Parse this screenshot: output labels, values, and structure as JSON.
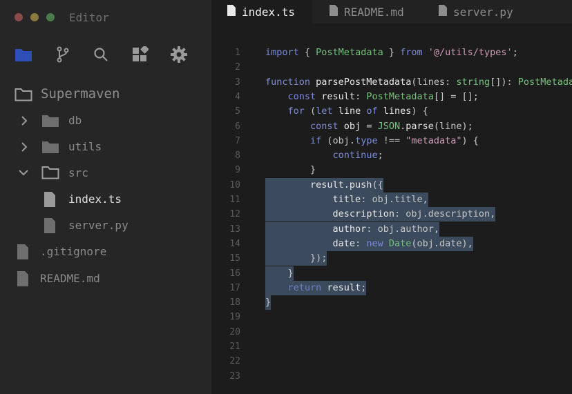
{
  "app": {
    "title": "Editor"
  },
  "activity_bar": [
    {
      "name": "explorer-icon"
    },
    {
      "name": "source-control-icon"
    },
    {
      "name": "search-icon"
    },
    {
      "name": "extensions-icon"
    },
    {
      "name": "settings-icon"
    }
  ],
  "explorer": {
    "root": "Supermaven",
    "items": [
      {
        "label": "db",
        "type": "folder",
        "expanded": false
      },
      {
        "label": "utils",
        "type": "folder",
        "expanded": false
      },
      {
        "label": "src",
        "type": "folder",
        "expanded": true
      },
      {
        "label": "index.ts",
        "type": "file",
        "selected": true
      },
      {
        "label": "server.py",
        "type": "file"
      },
      {
        "label": ".gitignore",
        "type": "file"
      },
      {
        "label": "README.md",
        "type": "file"
      }
    ]
  },
  "tabs": [
    {
      "label": "index.ts",
      "active": true
    },
    {
      "label": "README.md",
      "active": false
    },
    {
      "label": "server.py",
      "active": false
    }
  ],
  "code": {
    "line_numbers": [
      "1",
      "2",
      "3",
      "4",
      "5",
      "6",
      "7",
      "8",
      "9",
      "10",
      "11",
      "12",
      "13",
      "14",
      "15",
      "16",
      "17",
      "18",
      "19",
      "20",
      "21",
      "22",
      "23"
    ],
    "highlighted_lines": [
      10,
      11,
      12,
      13,
      14,
      15,
      16,
      17,
      18
    ],
    "lines": [
      [
        [
          "k",
          "import"
        ],
        [
          "p",
          " { "
        ],
        [
          "t",
          "PostMetadata"
        ],
        [
          "p",
          " } "
        ],
        [
          "k",
          "from"
        ],
        [
          "p",
          " "
        ],
        [
          "s",
          "'@/utils/types'"
        ],
        [
          "p",
          ";"
        ]
      ],
      [],
      [
        [
          "k",
          "function"
        ],
        [
          "f",
          " parsePostMetadata"
        ],
        [
          "p",
          "(lines: "
        ],
        [
          "t",
          "string"
        ],
        [
          "p",
          "[]): "
        ],
        [
          "t",
          "PostMetadat"
        ]
      ],
      [
        [
          "p",
          "    "
        ],
        [
          "k",
          "const"
        ],
        [
          "f",
          " result"
        ],
        [
          "p",
          ": "
        ],
        [
          "t",
          "PostMetadata"
        ],
        [
          "p",
          "[] = [];"
        ]
      ],
      [
        [
          "p",
          "    "
        ],
        [
          "k",
          "for"
        ],
        [
          "p",
          " ("
        ],
        [
          "k",
          "let"
        ],
        [
          "f",
          " line"
        ],
        [
          "p",
          " "
        ],
        [
          "k",
          "of"
        ],
        [
          "f",
          " lines"
        ],
        [
          "p",
          ") {"
        ]
      ],
      [
        [
          "p",
          "        "
        ],
        [
          "k",
          "const"
        ],
        [
          "f",
          " obj"
        ],
        [
          "p",
          " = "
        ],
        [
          "t",
          "JSON"
        ],
        [
          "p",
          "."
        ],
        [
          "f",
          "parse"
        ],
        [
          "p",
          "(line);"
        ]
      ],
      [
        [
          "p",
          "        "
        ],
        [
          "k",
          "if"
        ],
        [
          "p",
          " (obj."
        ],
        [
          "k",
          "type"
        ],
        [
          "p",
          " !== "
        ],
        [
          "s",
          "\"metadata\""
        ],
        [
          "p",
          ") {"
        ]
      ],
      [
        [
          "p",
          "            "
        ],
        [
          "k",
          "continue"
        ],
        [
          "p",
          ";"
        ]
      ],
      [
        [
          "p",
          "        }"
        ]
      ],
      [
        [
          "p",
          "        "
        ],
        [
          "f",
          "result.push"
        ],
        [
          "p",
          "({"
        ]
      ],
      [
        [
          "p",
          "            "
        ],
        [
          "f",
          "title"
        ],
        [
          "p",
          ": obj.title,"
        ]
      ],
      [
        [
          "p",
          "            "
        ],
        [
          "f",
          "description"
        ],
        [
          "p",
          ": obj.description,"
        ]
      ],
      [
        [
          "p",
          "            "
        ],
        [
          "f",
          "author"
        ],
        [
          "p",
          ": obj.author,"
        ]
      ],
      [
        [
          "p",
          "            "
        ],
        [
          "f",
          "date"
        ],
        [
          "p",
          ": "
        ],
        [
          "k",
          "new"
        ],
        [
          "p",
          " "
        ],
        [
          "t",
          "Date"
        ],
        [
          "p",
          "(obj.date),"
        ]
      ],
      [
        [
          "p",
          "        });"
        ]
      ],
      [
        [
          "p",
          "    }"
        ]
      ],
      [
        [
          "p",
          "    "
        ],
        [
          "dim",
          "return"
        ],
        [
          "f",
          " result"
        ],
        [
          "p",
          ";"
        ]
      ],
      [
        [
          "p",
          "}"
        ]
      ],
      [],
      [],
      [],
      [],
      []
    ]
  },
  "colors": {
    "sidebar_bg": "#262626",
    "editor_bg": "#1c1c1c",
    "selection": "#3b4a5c",
    "keyword": "#7b8cdb",
    "type": "#78c27e",
    "string": "#cf9bb8"
  }
}
